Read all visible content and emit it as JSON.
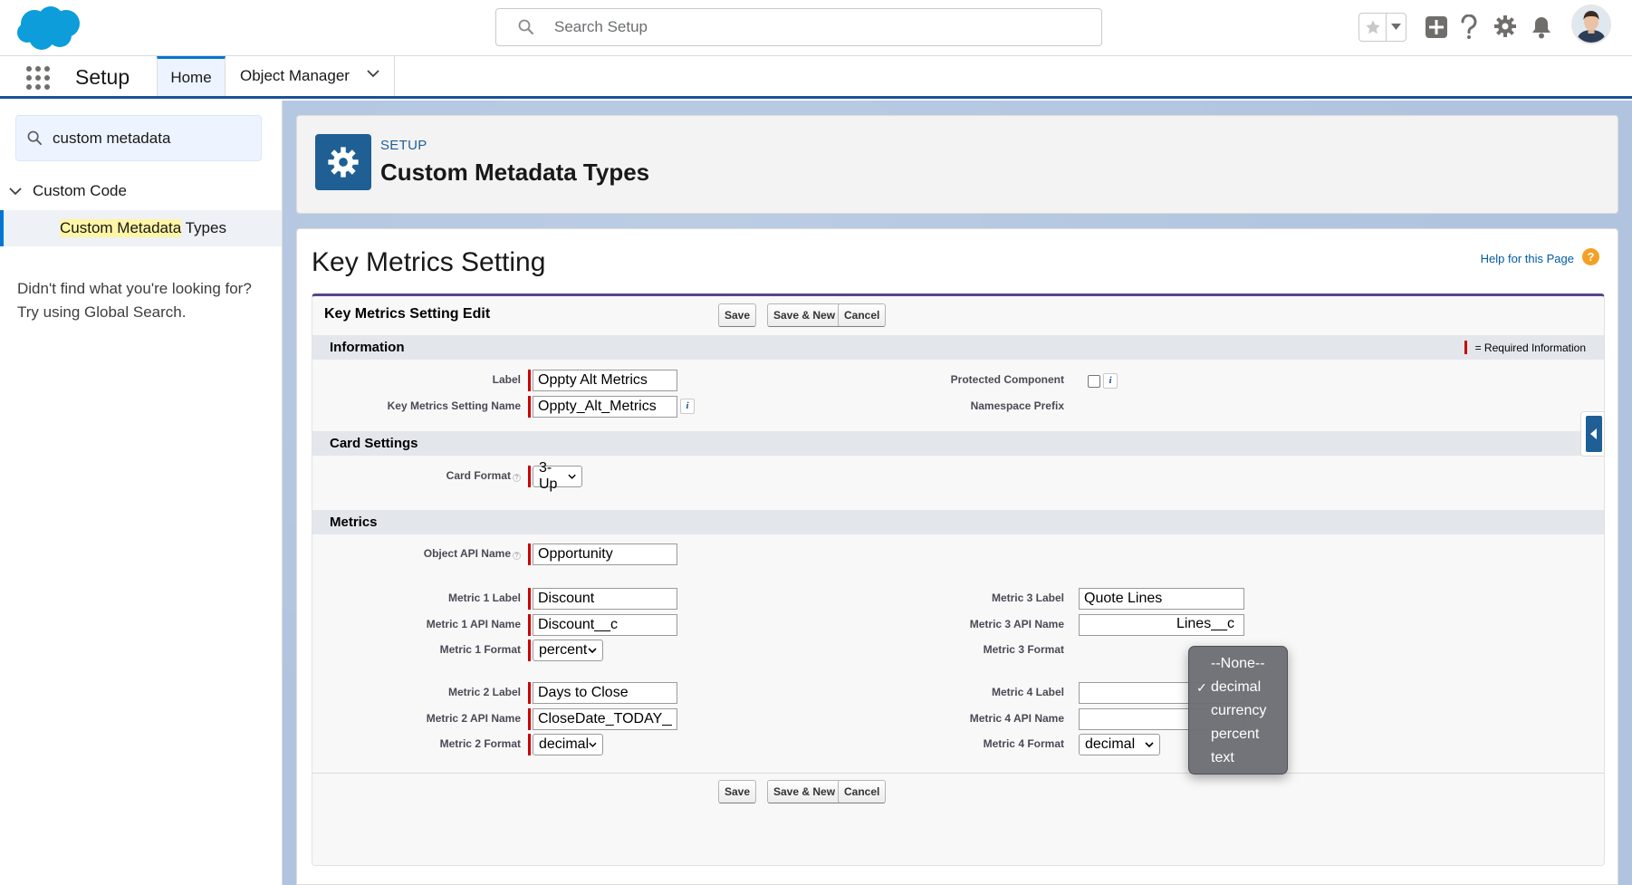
{
  "header": {
    "search_placeholder": "Search Setup",
    "icons": [
      "star-icon",
      "chevron-down-icon",
      "add-icon",
      "help-icon",
      "gear-icon",
      "bell-icon",
      "avatar"
    ]
  },
  "context": {
    "app_name": "Setup",
    "tabs": {
      "home": "Home",
      "object_manager": "Object Manager"
    }
  },
  "sidebar": {
    "quickfind_value": "custom metadata",
    "group_label": "Custom Code",
    "item_highlight": "Custom Metadata",
    "item_rest": " Types",
    "not_found_line1": "Didn't find what you're looking for?",
    "not_found_line2": "Try using Global Search."
  },
  "page_header": {
    "eyebrow": "SETUP",
    "title": "Custom Metadata Types"
  },
  "page": {
    "heading": "Key Metrics Setting",
    "help_link": "Help for this Page",
    "help_icon_glyph": "?"
  },
  "edit": {
    "title": "Key Metrics Setting Edit",
    "buttons": {
      "save": "Save",
      "save_new": "Save & New",
      "cancel": "Cancel"
    },
    "required_legend": "= Required Information",
    "sections": {
      "information": "Information",
      "card": "Card Settings",
      "metrics": "Metrics"
    },
    "info_glyph": "i",
    "tip_glyph": "?",
    "labels": {
      "label": "Label",
      "name": "Key Metrics Setting Name",
      "protected": "Protected Component",
      "namespace": "Namespace Prefix",
      "card_format": "Card Format",
      "object_api": "Object API Name",
      "m1_label": "Metric 1 Label",
      "m1_api": "Metric 1 API Name",
      "m1_format": "Metric 1 Format",
      "m2_label": "Metric 2 Label",
      "m2_api": "Metric 2 API Name",
      "m2_format": "Metric 2 Format",
      "m3_label": "Metric 3 Label",
      "m3_api": "Metric 3 API Name",
      "m3_format": "Metric 3 Format",
      "m4_label": "Metric 4 Label",
      "m4_api": "Metric 4 API Name",
      "m4_format": "Metric 4 Format"
    },
    "values": {
      "label": "Oppty Alt Metrics",
      "name": "Oppty_Alt_Metrics",
      "card_format": "3-Up",
      "object_api": "Opportunity",
      "m1_label": "Discount",
      "m1_api": "Discount__c",
      "m1_format": "percent",
      "m2_label": "Days to Close",
      "m2_api": "CloseDate_TODAY__c",
      "m2_format": "decimal",
      "m3_label": "Quote Lines",
      "m3_api_visible": "Lines__c",
      "m4_label": "",
      "m4_api": "",
      "m4_format": "decimal"
    },
    "protected_checked": false
  },
  "dropdown": {
    "options": [
      "--None--",
      "decimal",
      "currency",
      "percent",
      "text"
    ],
    "selected": "decimal",
    "check_glyph": "✓"
  },
  "colors": {
    "brand": "#0176d3",
    "setup_icon_bg": "#1f5f94",
    "required": "#cc0000",
    "page_bg": "#b0c4df"
  }
}
